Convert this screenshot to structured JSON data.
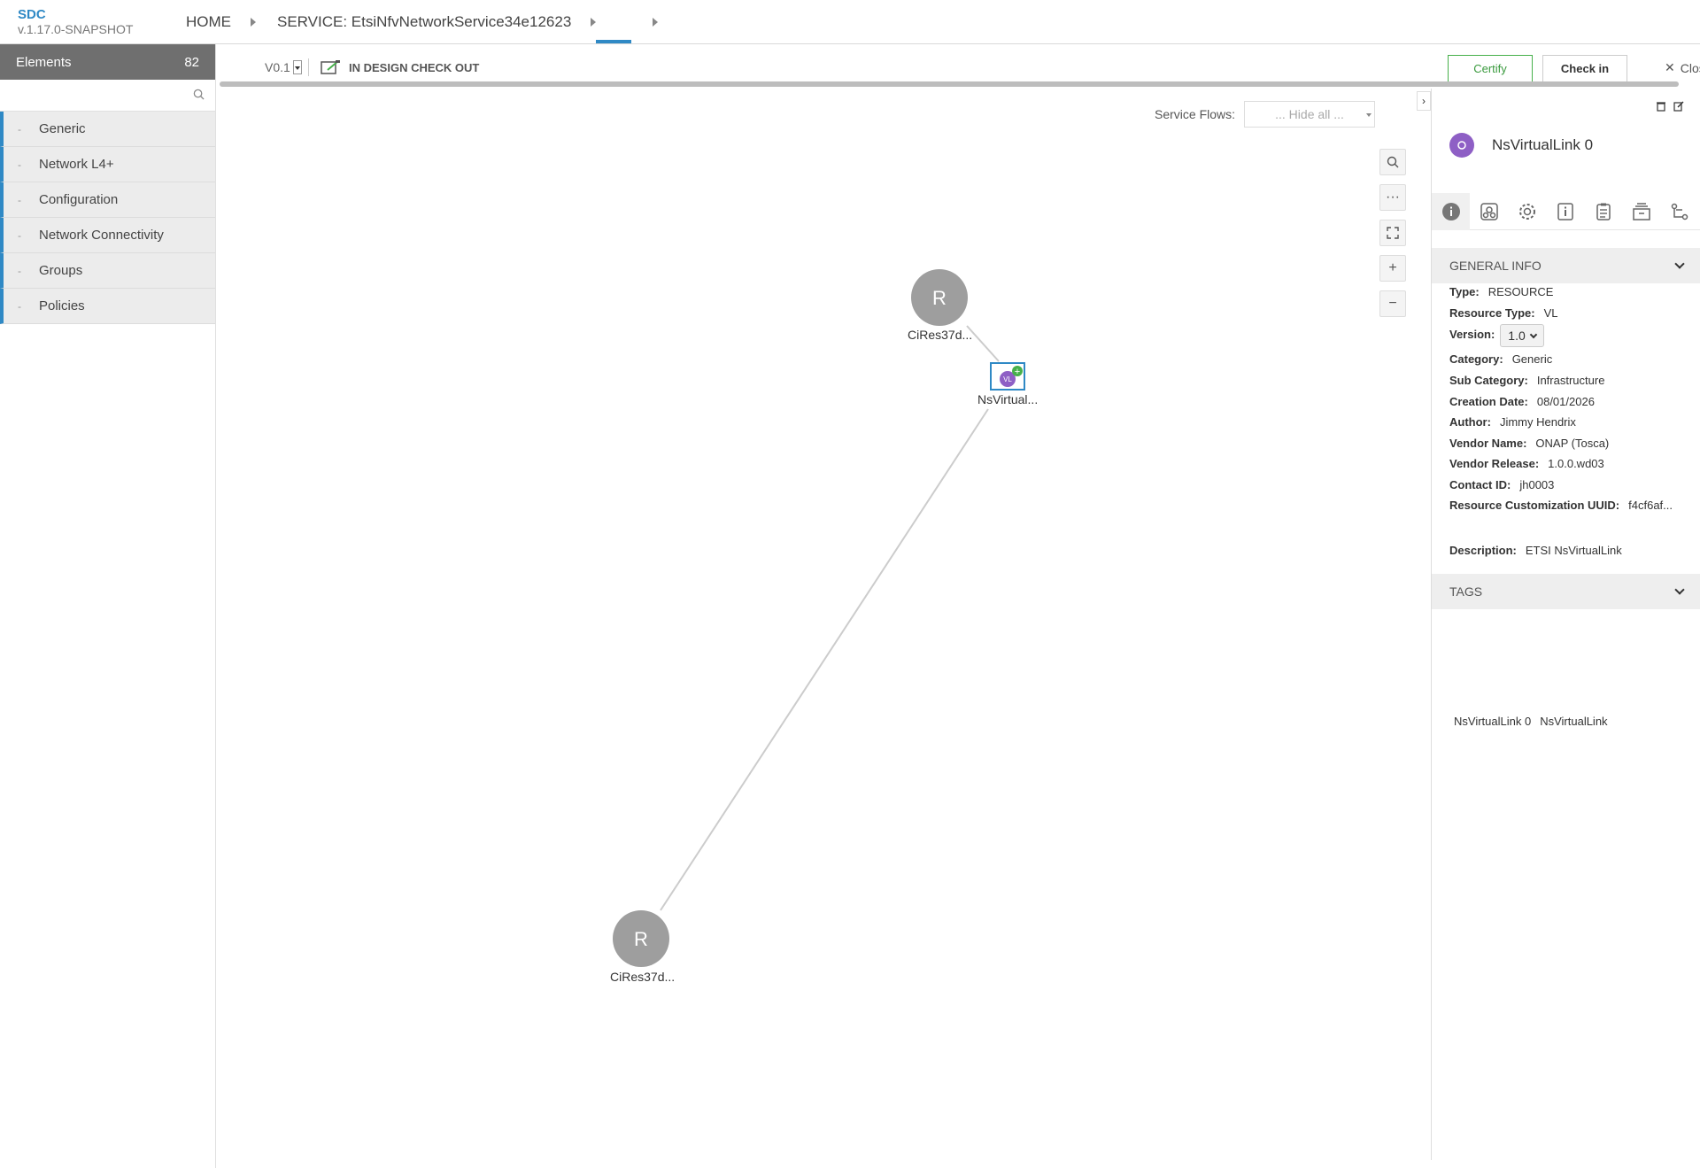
{
  "app": {
    "name": "SDC",
    "version": "v.1.17.0-SNAPSHOT"
  },
  "breadcrumb": {
    "home": "HOME",
    "service": "SERVICE: EtsiNfvNetworkService34e12623"
  },
  "elements": {
    "title": "Elements",
    "count": "82",
    "search_placeholder": "",
    "categories": [
      {
        "label": "Generic"
      },
      {
        "label": "Network L4+"
      },
      {
        "label": "Configuration"
      },
      {
        "label": "Network Connectivity"
      },
      {
        "label": "Groups"
      },
      {
        "label": "Policies"
      }
    ]
  },
  "workbar": {
    "version": "V0.1",
    "status": "IN DESIGN CHECK OUT",
    "certify": "Certify",
    "checkin": "Check in",
    "close": "Close"
  },
  "canvas": {
    "service_flows_label": "Service Flows:",
    "service_flows_value": "... Hide all ...",
    "nodes": [
      {
        "letter": "R",
        "label": "CiRes37d..."
      },
      {
        "label": "NsVirtual...",
        "badge": "VL"
      },
      {
        "letter": "R",
        "label": "CiRes37d..."
      }
    ]
  },
  "panel": {
    "title": "NsVirtualLink 0",
    "general_info": {
      "heading": "GENERAL INFO",
      "type_label": "Type:",
      "type": "RESOURCE",
      "resource_type_label": "Resource Type:",
      "resource_type": "VL",
      "version_label": "Version:",
      "version": "1.0",
      "category_label": "Category:",
      "category": "Generic",
      "sub_category_label": "Sub Category:",
      "sub_category": "Infrastructure",
      "creation_date_label": "Creation Date:",
      "creation_date": "08/01/2026",
      "author_label": "Author:",
      "author": "Jimmy Hendrix",
      "vendor_name_label": "Vendor Name:",
      "vendor_name": "ONAP (Tosca)",
      "vendor_release_label": "Vendor Release:",
      "vendor_release": "1.0.0.wd03",
      "contact_id_label": "Contact ID:",
      "contact_id": "jh0003",
      "uuid_label": "Resource Customization UUID:",
      "uuid": "f4cf6af...",
      "description_label": "Description:",
      "description": "ETSI NsVirtualLink"
    },
    "tags": {
      "heading": "TAGS",
      "items": [
        "NsVirtualLink 0",
        "NsVirtualLink"
      ]
    }
  },
  "colors": {
    "accent": "#2f89c5",
    "certify": "#46b04a",
    "vl_purple": "#8e5fc5",
    "node_gray": "#9e9e9e"
  }
}
